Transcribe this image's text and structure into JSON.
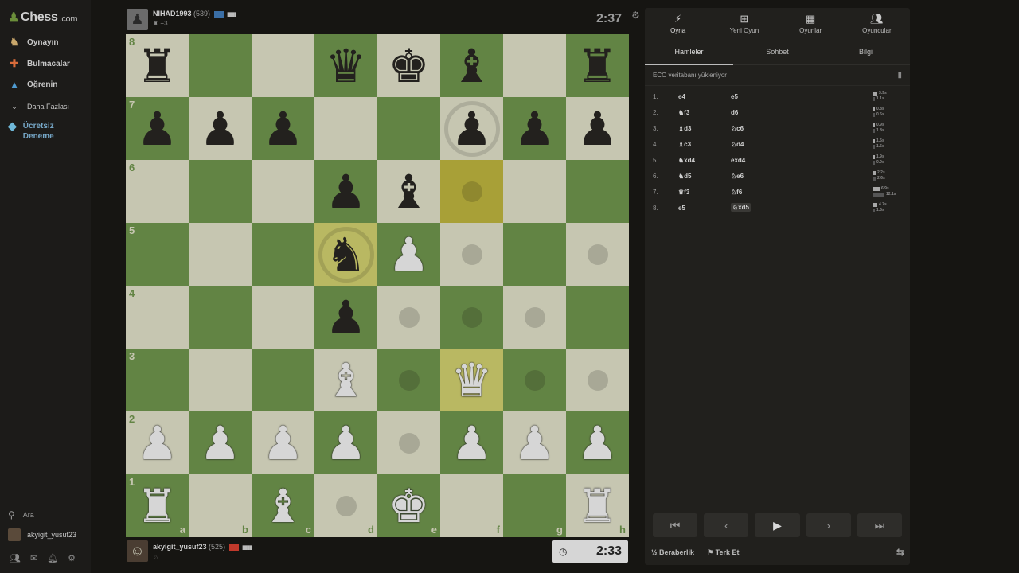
{
  "brand": {
    "name": "Chess",
    "suffix": ".com"
  },
  "sidebar": {
    "items": [
      {
        "label": "Oynayın",
        "icon": "play-icon"
      },
      {
        "label": "Bulmacalar",
        "icon": "puzzle-icon"
      },
      {
        "label": "Öğrenin",
        "icon": "learn-icon"
      },
      {
        "label": "Daha Fazlası",
        "icon": "chevron-down-icon"
      }
    ],
    "trial_line1": "Ücretsiz",
    "trial_line2": "Deneme",
    "search_label": "Ara",
    "username": "akyigit_yusuf23"
  },
  "opponent": {
    "name": "NIHAD1993",
    "rating": "(539)",
    "meta": "+3",
    "clock": "2:37",
    "flag_color": "#3a6ea5"
  },
  "player": {
    "name": "akyigit_yusuf23",
    "rating": "(525)",
    "clock": "2:33",
    "flag_color": "#c0392b"
  },
  "board": {
    "ranks": [
      "8",
      "7",
      "6",
      "5",
      "4",
      "3",
      "2",
      "1"
    ],
    "files": [
      "a",
      "b",
      "c",
      "d",
      "e",
      "f",
      "g",
      "h"
    ],
    "colors": {
      "light": "#d7d7c0",
      "dark": "#6b8f4a",
      "highlight": "#b7ae3c"
    }
  },
  "panel": {
    "tabs": [
      {
        "label": "Oyna",
        "icon": "lightning-icon"
      },
      {
        "label": "Yeni Oyun",
        "icon": "plus-icon"
      },
      {
        "label": "Oyunlar",
        "icon": "board-icon"
      },
      {
        "label": "Oyuncular",
        "icon": "players-icon"
      }
    ],
    "subtabs": [
      "Hamleler",
      "Sohbet",
      "Bilgi"
    ],
    "eco_text": "ECO veritabanı yükleniyor",
    "moves": [
      {
        "n": "1.",
        "w": "e4",
        "b": "e5",
        "wt": "3.9s",
        "bt": "1.1s"
      },
      {
        "n": "2.",
        "w": "♞f3",
        "b": "d6",
        "wt": "0.8s",
        "bt": "0.5s"
      },
      {
        "n": "3.",
        "w": "♝d3",
        "b": "♘c6",
        "wt": "0.9s",
        "bt": "1.8s"
      },
      {
        "n": "4.",
        "w": "♝c3",
        "b": "♘d4",
        "wt": "1.5s",
        "bt": "1.5s"
      },
      {
        "n": "5.",
        "w": "♞xd4",
        "b": "exd4",
        "wt": "1.9s",
        "bt": "0.9s"
      },
      {
        "n": "6.",
        "w": "♞d5",
        "b": "♘e6",
        "wt": "2.2s",
        "bt": "2.6s"
      },
      {
        "n": "7.",
        "w": "♛f3",
        "b": "♘f6",
        "wt": "6.9s",
        "bt": "12.1s"
      },
      {
        "n": "8.",
        "w": "e5",
        "b": "♘xd5",
        "wt": "4.7s",
        "bt": "1.5s"
      }
    ],
    "draw_label": "Beraberlik",
    "draw_prefix": "½",
    "resign_label": "Terk Et"
  }
}
